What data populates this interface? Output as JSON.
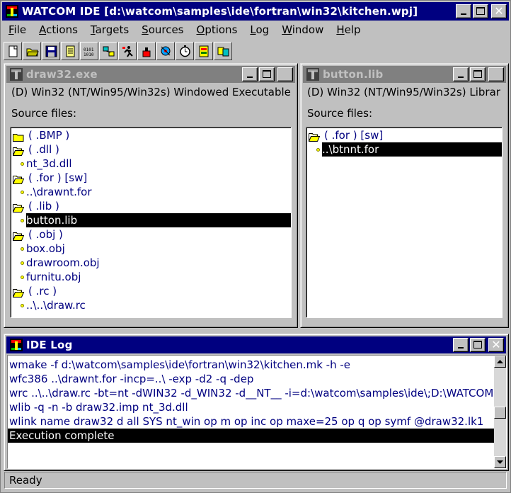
{
  "app": {
    "title": "WATCOM IDE [d:\\watcom\\samples\\ide\\fortran\\win32\\kitchen.wpj]"
  },
  "menu": [
    {
      "label": "File",
      "accel": "F",
      "rest": "ile"
    },
    {
      "label": "Actions",
      "accel": "A",
      "rest": "ctions"
    },
    {
      "label": "Targets",
      "accel": "T",
      "rest": "argets"
    },
    {
      "label": "Sources",
      "accel": "S",
      "rest": "ources"
    },
    {
      "label": "Options",
      "accel": "O",
      "rest": "ptions"
    },
    {
      "label": "Log",
      "accel": "L",
      "rest": "og"
    },
    {
      "label": "Window",
      "accel": "W",
      "rest": "indow"
    },
    {
      "label": "Help",
      "accel": "H",
      "rest": "elp"
    }
  ],
  "toolbar": [
    "new-project-icon",
    "open-project-icon",
    "save-project-icon",
    "notes-icon",
    "make-target-icon",
    "browse-icon",
    "run-icon",
    "debug-icon",
    "sample-icon",
    "profile-timer-icon",
    "resource-editor-icon",
    "dll-icon"
  ],
  "targets": [
    {
      "title": "draw32.exe",
      "description": "(D) Win32 (NT/Win95/Win32s) Windowed Executable",
      "source_label": "Source files:",
      "items": [
        {
          "kind": "folder",
          "text": "( .BMP )",
          "open": false
        },
        {
          "kind": "folder",
          "text": "( .dll )",
          "open": true
        },
        {
          "kind": "file",
          "text": "nt_3d.dll"
        },
        {
          "kind": "folder",
          "text": "( .for ) [sw]",
          "open": true
        },
        {
          "kind": "file",
          "text": "..\\drawnt.for"
        },
        {
          "kind": "folder",
          "text": "( .lib )",
          "open": true
        },
        {
          "kind": "file",
          "text": "button.lib",
          "selected": true
        },
        {
          "kind": "folder",
          "text": "( .obj )",
          "open": true
        },
        {
          "kind": "file",
          "text": "box.obj"
        },
        {
          "kind": "file",
          "text": "drawroom.obj"
        },
        {
          "kind": "file",
          "text": "furnitu.obj"
        },
        {
          "kind": "folder",
          "text": "( .rc )",
          "open": true
        },
        {
          "kind": "file",
          "text": "..\\..\\draw.rc"
        }
      ]
    },
    {
      "title": "button.lib",
      "description": "(D) Win32 (NT/Win95/Win32s) Librar",
      "source_label": "Source files:",
      "items": [
        {
          "kind": "folder",
          "text": "( .for ) [sw]",
          "open": true
        },
        {
          "kind": "file",
          "text": "..\\btnnt.for",
          "selected": true
        }
      ]
    }
  ],
  "log": {
    "title": "IDE Log",
    "lines": [
      "wmake -f d:\\watcom\\samples\\ide\\fortran\\win32\\kitchen.mk -h -e",
      "wfc386 ..\\drawnt.for -incp=..\\ -exp -d2 -q -dep",
      "wrc ..\\..\\draw.rc -bt=nt -dWIN32 -d_WIN32 -d__NT__ -i=d:\\watcom\\samples\\ide\\;D:\\WATCOM",
      "wlib -q -n -b draw32.imp nt_3d.dll",
      "wlink name draw32 d all SYS nt_win op m op inc op maxe=25 op q op symf @draw32.lk1",
      "Execution complete"
    ],
    "selected_index": 5
  },
  "status": {
    "text": "Ready"
  },
  "colors": {
    "active_title": "#000080",
    "inactive_title": "#808080",
    "list_text": "#000080",
    "face": "#c0c0c0"
  }
}
